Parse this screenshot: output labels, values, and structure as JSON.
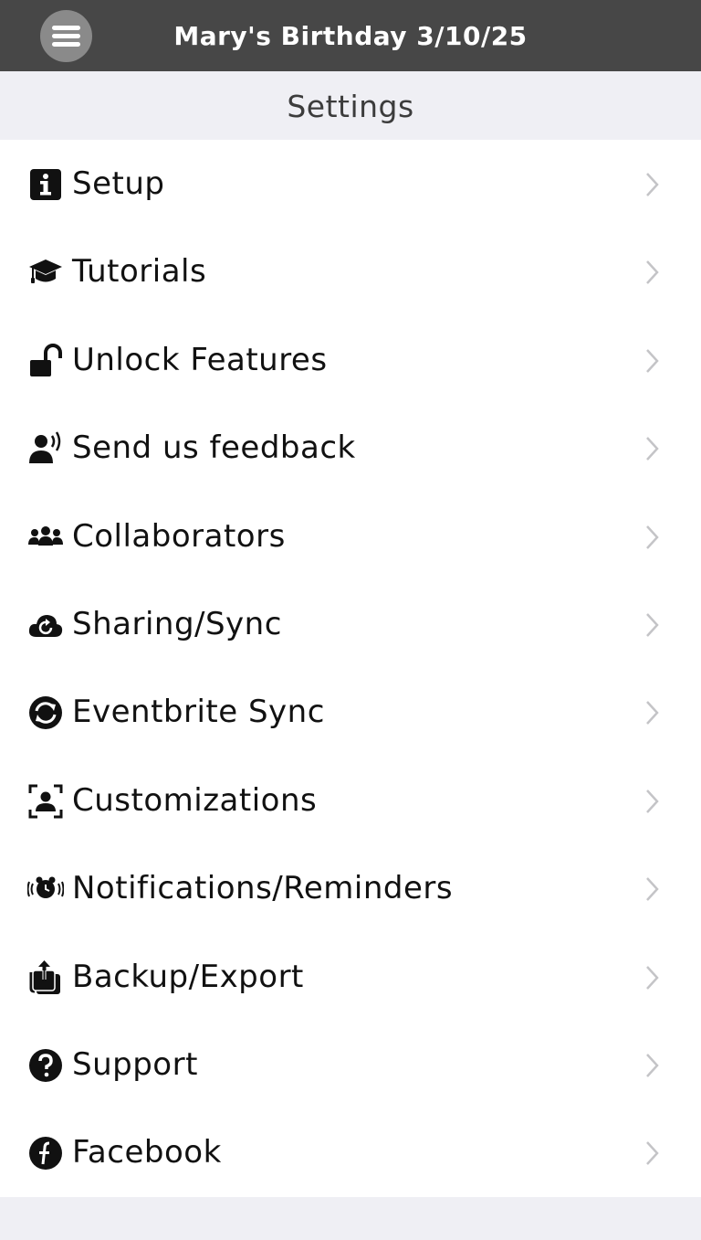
{
  "header": {
    "title": "Mary's Birthday 3/10/25",
    "menu_icon": "hamburger-menu-icon"
  },
  "section": {
    "title": "Settings"
  },
  "colors": {
    "topbar": "#474747",
    "menu_button": "#8a8a8a",
    "section_bg": "#efeff4",
    "text": "#111111",
    "chevron": "#c4c4c7"
  },
  "items": [
    {
      "label": "Setup",
      "icon": "info-square-icon"
    },
    {
      "label": "Tutorials",
      "icon": "graduation-cap-icon"
    },
    {
      "label": "Unlock Features",
      "icon": "unlock-icon"
    },
    {
      "label": "Send us feedback",
      "icon": "user-speaking-icon"
    },
    {
      "label": "Collaborators",
      "icon": "users-icon"
    },
    {
      "label": "Sharing/Sync",
      "icon": "cloud-sync-icon"
    },
    {
      "label": "Eventbrite Sync",
      "icon": "sync-circle-icon"
    },
    {
      "label": "Customizations",
      "icon": "user-frame-icon"
    },
    {
      "label": "Notifications/Reminders",
      "icon": "alarm-ringing-icon"
    },
    {
      "label": "Backup/Export",
      "icon": "export-icon"
    },
    {
      "label": "Support",
      "icon": "question-circle-icon"
    },
    {
      "label": "Facebook",
      "icon": "facebook-icon"
    }
  ]
}
